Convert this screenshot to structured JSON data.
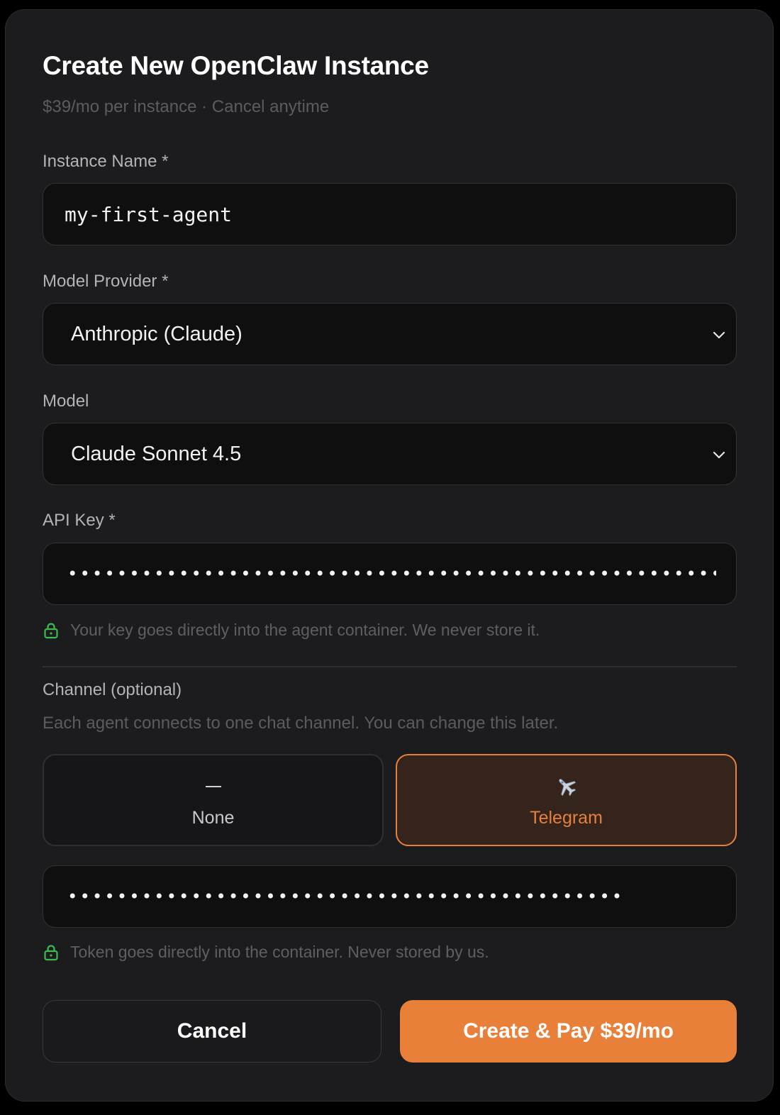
{
  "modal": {
    "title": "Create New OpenClaw Instance",
    "subtitle": "$39/mo per instance · Cancel anytime"
  },
  "instance_name": {
    "label": "Instance Name *",
    "value": "my-first-agent"
  },
  "model_provider": {
    "label": "Model Provider *",
    "selected": "Anthropic (Claude)"
  },
  "model": {
    "label": "Model",
    "selected": "Claude Sonnet 4.5"
  },
  "api_key": {
    "label": "API Key *",
    "masked_value": "•••••••••••••••••••••••••••••••••••••••••••••••••••••••••",
    "hint": "Your key goes directly into the agent container. We never store it."
  },
  "channel": {
    "label": "Channel (optional)",
    "description": "Each agent connects to one chat channel. You can change this later.",
    "options": [
      {
        "label": "None",
        "icon": "dash-icon",
        "selected": false
      },
      {
        "label": "Telegram",
        "icon": "airplane-icon",
        "selected": true
      }
    ],
    "token": {
      "masked_value": "•••••••••••••••••••••••••••••••••••••••••••••",
      "hint": "Token goes directly into the container. Never stored by us."
    }
  },
  "actions": {
    "cancel_label": "Cancel",
    "create_label": "Create & Pay $39/mo"
  },
  "colors": {
    "accent": "#e8803a",
    "lock_icon": "#3fb950",
    "modal_bg": "#1c1c1e",
    "field_bg": "#0f0f10"
  }
}
